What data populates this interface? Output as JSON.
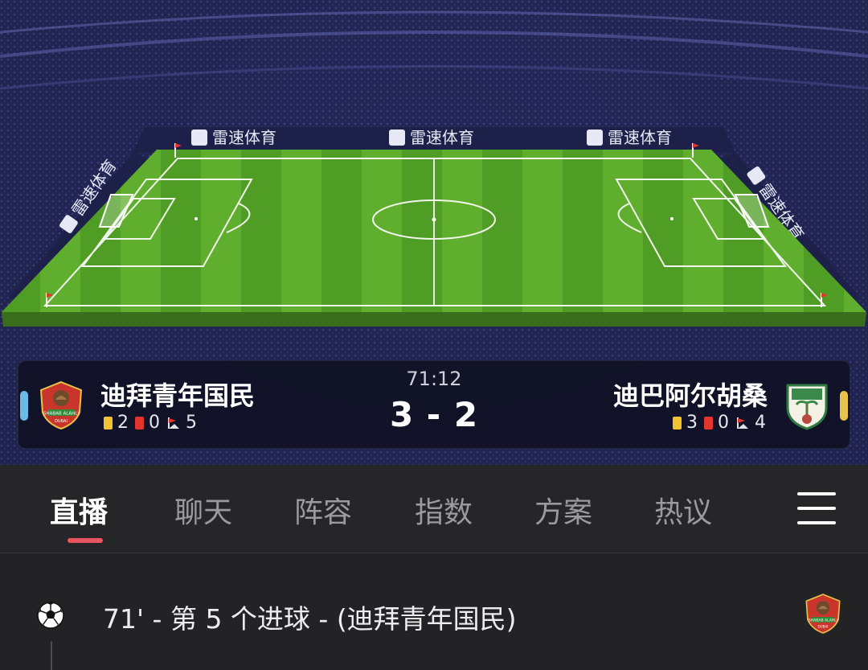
{
  "brand": {
    "ad_text": "雷速体育"
  },
  "match": {
    "time": "71:12",
    "score": "3 - 2",
    "home": {
      "name": "迪拜青年国民",
      "yellow_cards": "2",
      "red_cards": "0",
      "corners": "5",
      "crest_text_top": "SHABAB ALAHLI",
      "crest_text_bottom": "DUBAI",
      "side_color": "#6fb8ea"
    },
    "away": {
      "name": "迪巴阿尔胡桑",
      "yellow_cards": "3",
      "red_cards": "0",
      "corners": "4",
      "side_color": "#e8c24a"
    }
  },
  "tabs": {
    "items": [
      {
        "label": "直播",
        "active": true
      },
      {
        "label": "聊天",
        "active": false
      },
      {
        "label": "阵容",
        "active": false
      },
      {
        "label": "指数",
        "active": false
      },
      {
        "label": "方案",
        "active": false
      },
      {
        "label": "热议",
        "active": false
      }
    ],
    "menu_icon": "hamburger-menu-icon",
    "indicator_color": "#e8545d"
  },
  "events": [
    {
      "icon": "soccer-ball-icon",
      "text": "71' - 第 5 个进球 - (迪拜青年国民)"
    }
  ]
}
